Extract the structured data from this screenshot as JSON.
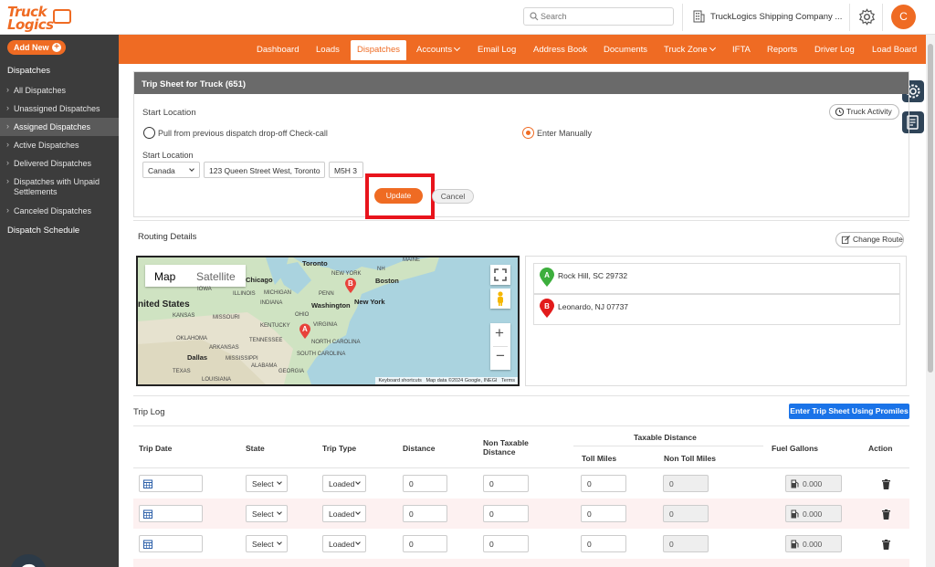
{
  "topbar": {
    "logo_line1": "Truck",
    "logo_line2": "Logics",
    "search_placeholder": "Search",
    "company_name": "TruckLogics Shipping Company ...",
    "avatar_initial": "C"
  },
  "sidebar": {
    "add_new": "Add New",
    "section_title": "Dispatches",
    "items": [
      {
        "label": "All Dispatches"
      },
      {
        "label": "Unassigned Dispatches"
      },
      {
        "label": "Assigned Dispatches"
      },
      {
        "label": "Active Dispatches"
      },
      {
        "label": "Delivered Dispatches"
      },
      {
        "label": "Dispatches with Unpaid Settlements"
      },
      {
        "label": "Canceled Dispatches"
      }
    ],
    "schedule": "Dispatch Schedule"
  },
  "nav": {
    "items": [
      {
        "label": "Dashboard"
      },
      {
        "label": "Loads"
      },
      {
        "label": "Dispatches"
      },
      {
        "label": "Accounts"
      },
      {
        "label": "Email Log"
      },
      {
        "label": "Address Book"
      },
      {
        "label": "Documents"
      },
      {
        "label": "Truck Zone"
      },
      {
        "label": "IFTA"
      },
      {
        "label": "Reports"
      },
      {
        "label": "Driver Log"
      },
      {
        "label": "Load Board"
      }
    ]
  },
  "trip_sheet": {
    "title": "Trip Sheet for Truck (651)",
    "start_location_heading": "Start Location",
    "truck_activity": "Truck Activity",
    "option_previous": "Pull from previous dispatch drop-off Check-call",
    "option_manual": "Enter Manually",
    "start_location_label": "Start Location",
    "country": "Canada",
    "address": "123 Queen Street West, Toronto",
    "postal": "M5H 3",
    "update": "Update",
    "cancel": "Cancel"
  },
  "routing": {
    "title": "Routing Details",
    "change_route": "Change Route",
    "map_tab_map": "Map",
    "map_tab_satellite": "Satellite",
    "map_credit_shortcuts": "Keyboard shortcuts",
    "map_credit_data": "Map data ©2024 Google, INEGI",
    "map_credit_terms": "Terms",
    "map_labels": {
      "toronto": "Toronto",
      "boston": "Boston",
      "new_york": "New York",
      "chicago": "Chicago",
      "washington": "Washington",
      "united_states": "nited States",
      "michigan": "MICHIGAN",
      "ohio": "OHIO",
      "indiana": "INDIANA",
      "illinois": "ILLINOIS",
      "iowa": "IOWA",
      "kansas": "KANSAS",
      "missouri": "MISSOURI",
      "kentucky": "KENTUCKY",
      "virginia": "VIRGINIA",
      "tennessee": "TENNESSEE",
      "oklahoma": "OKLAHOMA",
      "arkansas": "ARKANSAS",
      "south_carolina": "SOUTH CAROLINA",
      "north_carolina": "NORTH CAROLINA",
      "mississippi": "MISSISSIPPI",
      "alabama": "ALABAMA",
      "georgia": "GEORGIA",
      "texas": "TEXAS",
      "louisiana": "LOUISIANA",
      "dallas": "Dallas",
      "penn": "PENN",
      "new_york_state": "NEW YORK",
      "maine": "MAINE",
      "nh": "NH"
    },
    "marker_a": "A",
    "marker_b": "B",
    "stops": [
      {
        "marker": "A",
        "label": "Rock Hill, SC 29732",
        "color": "#3cae3c"
      },
      {
        "marker": "B",
        "label": "Leonardo, NJ 07737",
        "color": "#e21b1b"
      }
    ]
  },
  "trip_log": {
    "title": "Trip Log",
    "promiles_button": "Enter Trip Sheet Using Promiles",
    "headers": {
      "trip_date": "Trip Date",
      "state": "State",
      "trip_type": "Trip Type",
      "distance": "Distance",
      "non_taxable": "Non Taxable Distance",
      "taxable": "Taxable Distance",
      "toll": "Toll Miles",
      "non_toll": "Non Toll Miles",
      "fuel": "Fuel Gallons",
      "action": "Action"
    },
    "rows": [
      {
        "state": "Select",
        "trip_type": "Loaded",
        "distance": "0",
        "non_taxable": "0",
        "toll": "0",
        "non_toll": "0",
        "fuel": "0.000"
      },
      {
        "state": "Select",
        "trip_type": "Loaded",
        "distance": "0",
        "non_taxable": "0",
        "toll": "0",
        "non_toll": "0",
        "fuel": "0.000"
      },
      {
        "state": "Select",
        "trip_type": "Loaded",
        "distance": "0",
        "non_taxable": "0",
        "toll": "0",
        "non_toll": "0",
        "fuel": "0.000"
      }
    ]
  },
  "colors": {
    "brand_orange": "#ef6b23",
    "sidebar_bg": "#3c3c3c",
    "highlight_red": "#e8141c",
    "button_blue": "#1a73e8"
  }
}
